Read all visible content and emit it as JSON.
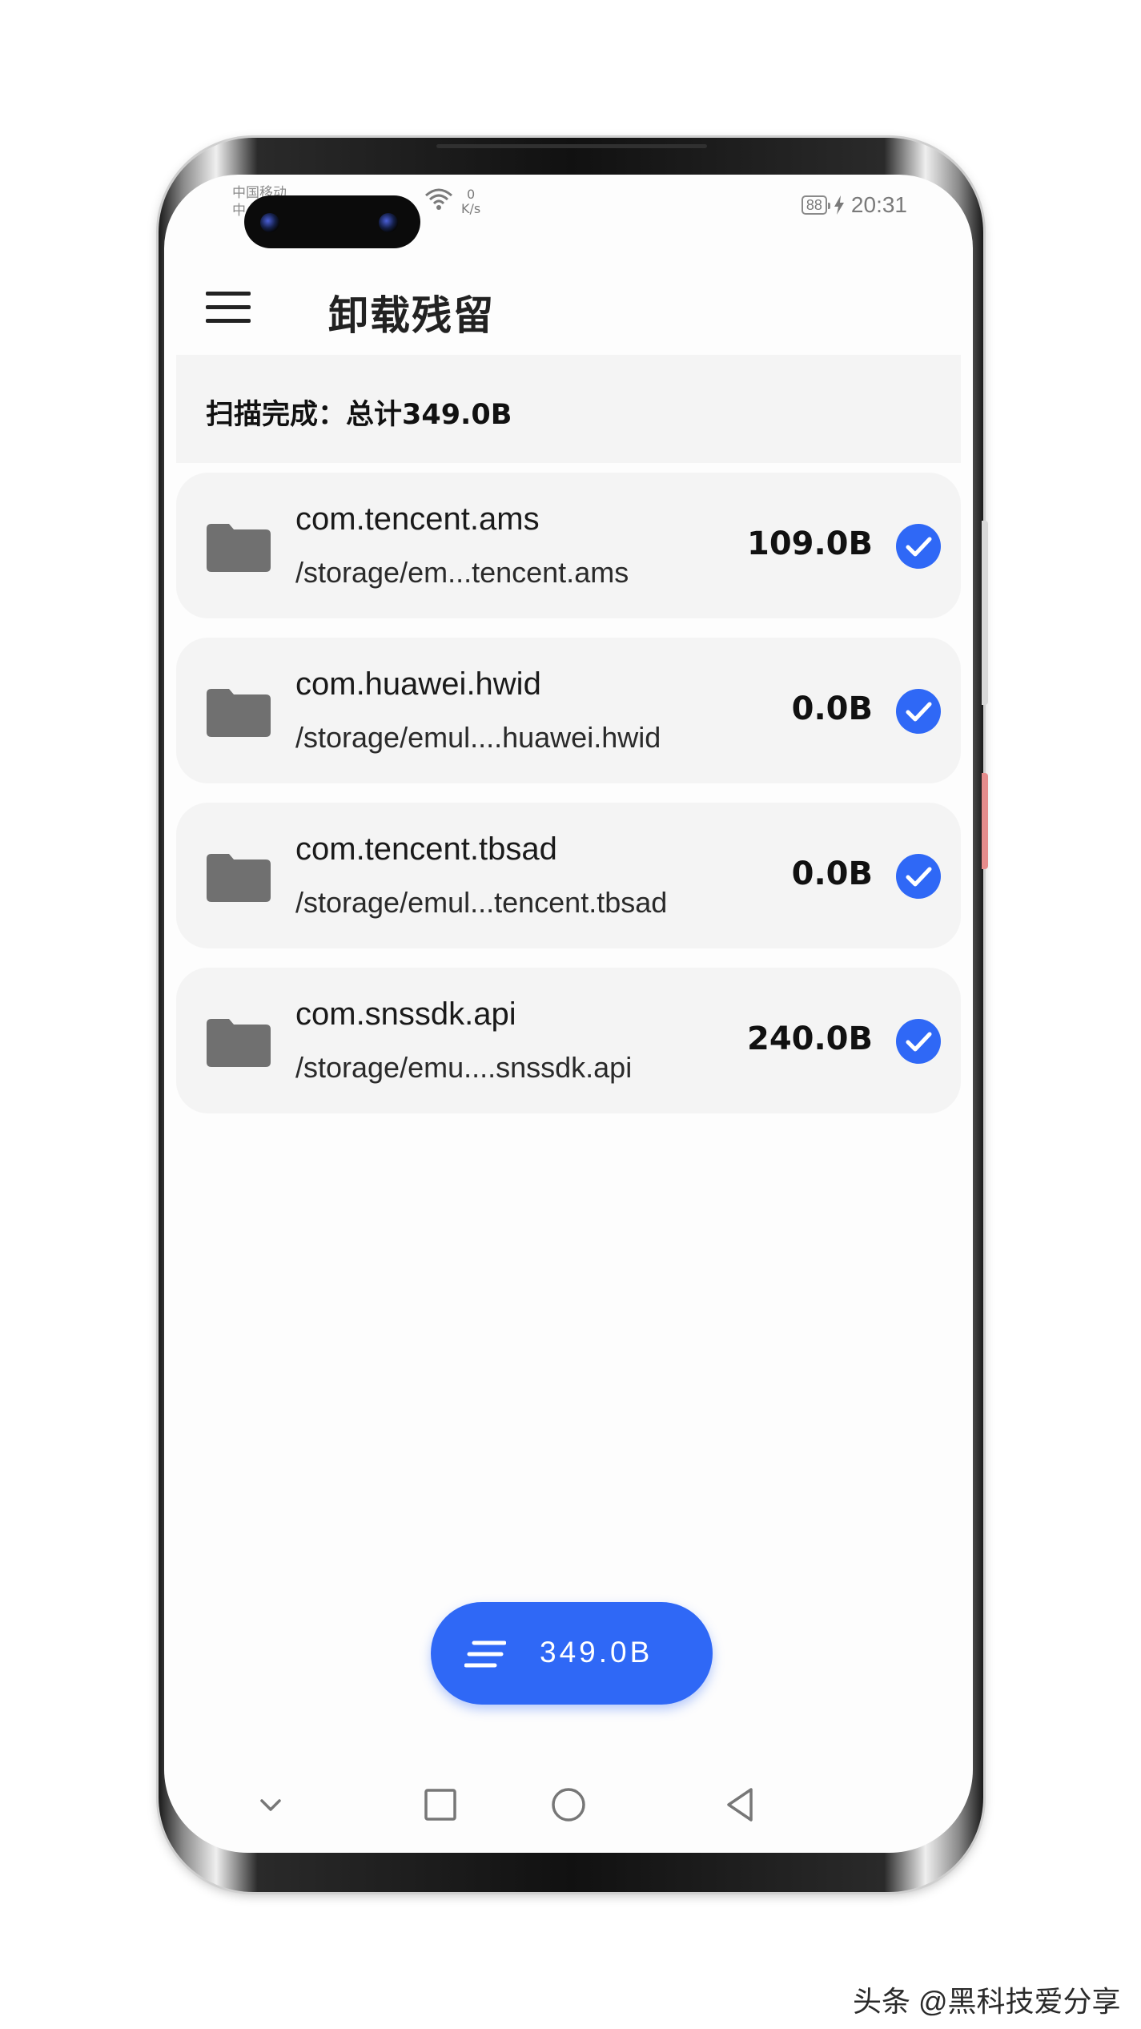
{
  "status_bar": {
    "carrier_line1": "中国移动",
    "carrier_line2": "中",
    "speed_value": "0",
    "speed_unit": "K/s",
    "battery": "88",
    "time": "20:31"
  },
  "app_bar": {
    "title": "卸载残留"
  },
  "summary": {
    "text": "扫描完成：总计349.0B"
  },
  "items": [
    {
      "name": "com.tencent.ams",
      "path": "/storage/em...tencent.ams",
      "size": "109.0B",
      "checked": true
    },
    {
      "name": "com.huawei.hwid",
      "path": "/storage/emul....huawei.hwid",
      "size": "0.0B",
      "checked": true
    },
    {
      "name": "com.tencent.tbsad",
      "path": "/storage/emul...tencent.tbsad",
      "size": "0.0B",
      "checked": true
    },
    {
      "name": "com.snssdk.api",
      "path": "/storage/emu....snssdk.api",
      "size": "240.0B",
      "checked": true
    }
  ],
  "fab": {
    "label": "349.0B",
    "icon": "clean-lines-icon"
  },
  "nav_bar": {
    "icons": [
      "chevron-down-icon",
      "square-recents-icon",
      "circle-home-icon",
      "triangle-back-icon"
    ]
  },
  "colors": {
    "accent": "#2f68f6",
    "card_bg": "#f4f4f4",
    "folder": "#707070"
  },
  "watermark": "头条 @黑科技爱分享"
}
